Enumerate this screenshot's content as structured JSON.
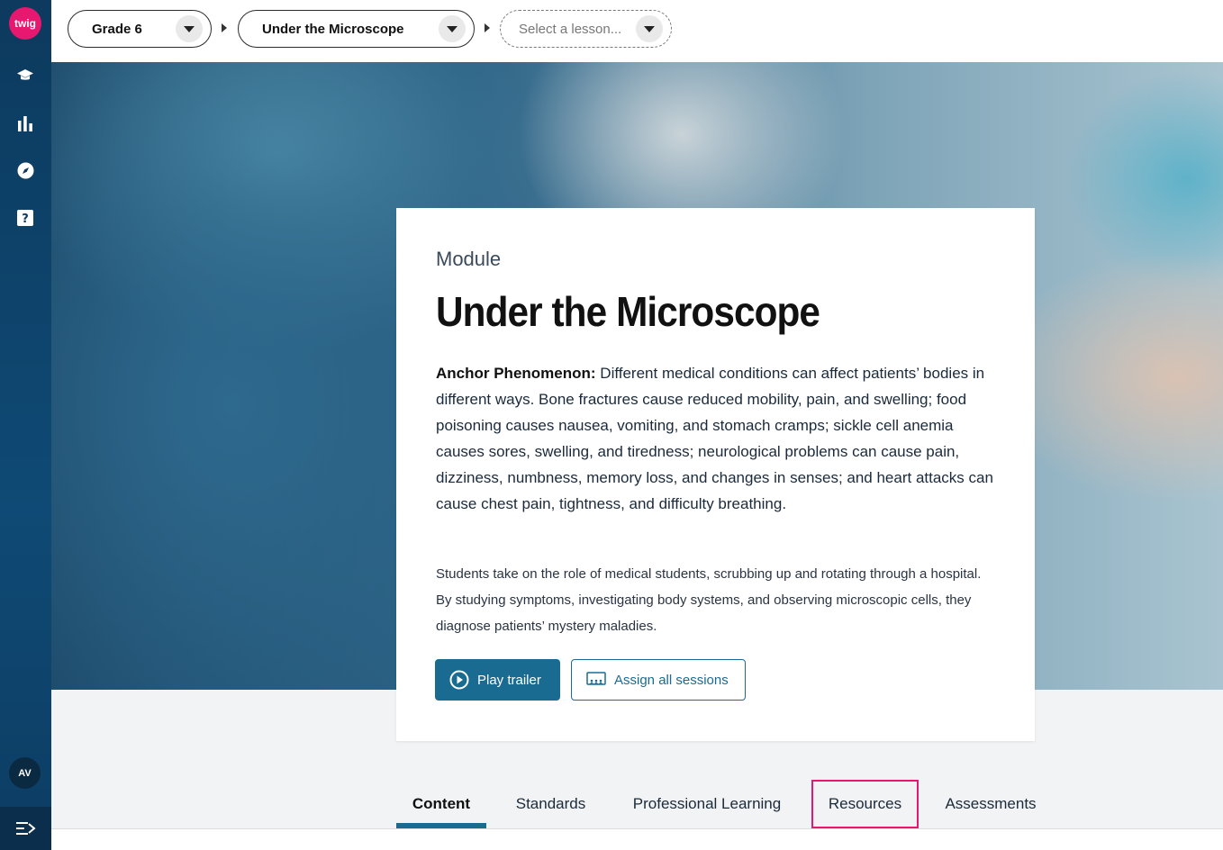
{
  "sidebar": {
    "logo_text": "twig",
    "icons": [
      "graduation-cap-icon",
      "bar-chart-icon",
      "compass-icon",
      "help-icon"
    ],
    "avatar_initials": "AV",
    "menu_icon": "collapse-menu-icon"
  },
  "breadcrumb": {
    "grade": "Grade 6",
    "module": "Under the Microscope",
    "lesson_placeholder": "Select a lesson..."
  },
  "card": {
    "label": "Module",
    "title": "Under the Microscope",
    "anchor_label": "Anchor Phenomenon:",
    "anchor_text": " Different medical conditions can affect patients’ bodies in different ways. Bone fractures cause reduced mobility, pain, and swelling; food poisoning causes nausea, vomiting, and stomach cramps; sickle cell anemia causes sores, swelling, and tiredness; neurological problems can cause pain, dizziness, numbness, memory loss, and changes in senses; and heart attacks can cause chest pain, tightness, and difficulty breathing.",
    "description": "Students take on the role of medical students, scrubbing up and rotating through a hospital. By studying symptoms, investigating body systems, and observing microscopic cells, they diagnose patients’ mystery maladies.",
    "play_trailer": "Play trailer",
    "assign_all": "Assign all sessions"
  },
  "tabs": [
    "Content",
    "Standards",
    "Professional Learning",
    "Resources",
    "Assessments"
  ],
  "colors": {
    "brand_pink": "#e8176f",
    "primary_blue": "#1a6b91",
    "sidebar_navy": "#0d3a5e"
  }
}
